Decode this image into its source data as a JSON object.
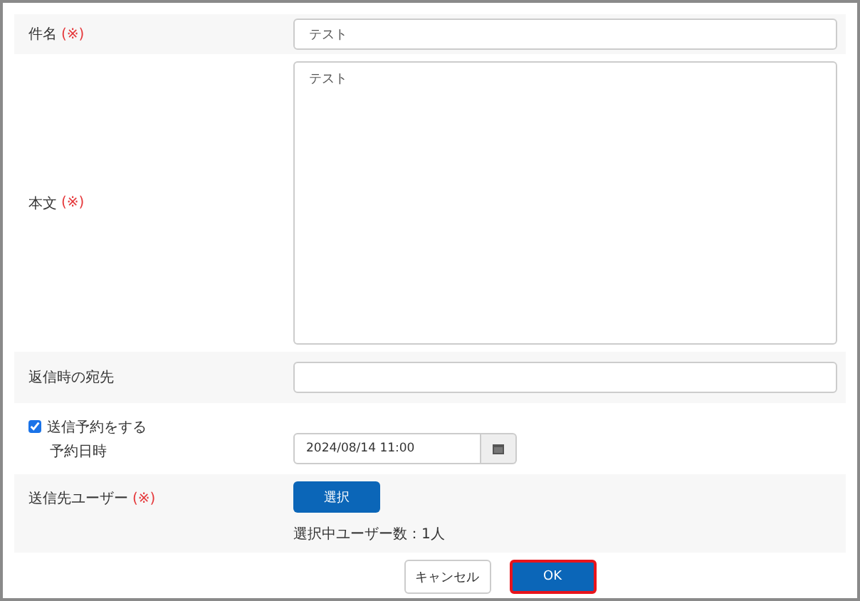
{
  "fields": [
    {
      "kind": "text",
      "label": "件名",
      "required_mark": "(※)",
      "value": "テスト"
    },
    {
      "kind": "textarea",
      "label": "本文",
      "required_mark": "(※)",
      "value": "テスト"
    },
    {
      "kind": "text",
      "label": "返信時の宛先"
    },
    {
      "kind": "schedule",
      "checkbox_label": "送信予約をする",
      "checked": true,
      "label": "予約日時",
      "value": "2024/08/14 11:00"
    },
    {
      "kind": "users",
      "label": "送信先ユーザー",
      "required_mark": "(※)",
      "button": "選択",
      "count": "選択中ユーザー数：1人"
    }
  ],
  "buttons": [
    {
      "label": "キャンセル",
      "kind": "default"
    },
    {
      "label": "OK",
      "kind": "primary"
    }
  ]
}
